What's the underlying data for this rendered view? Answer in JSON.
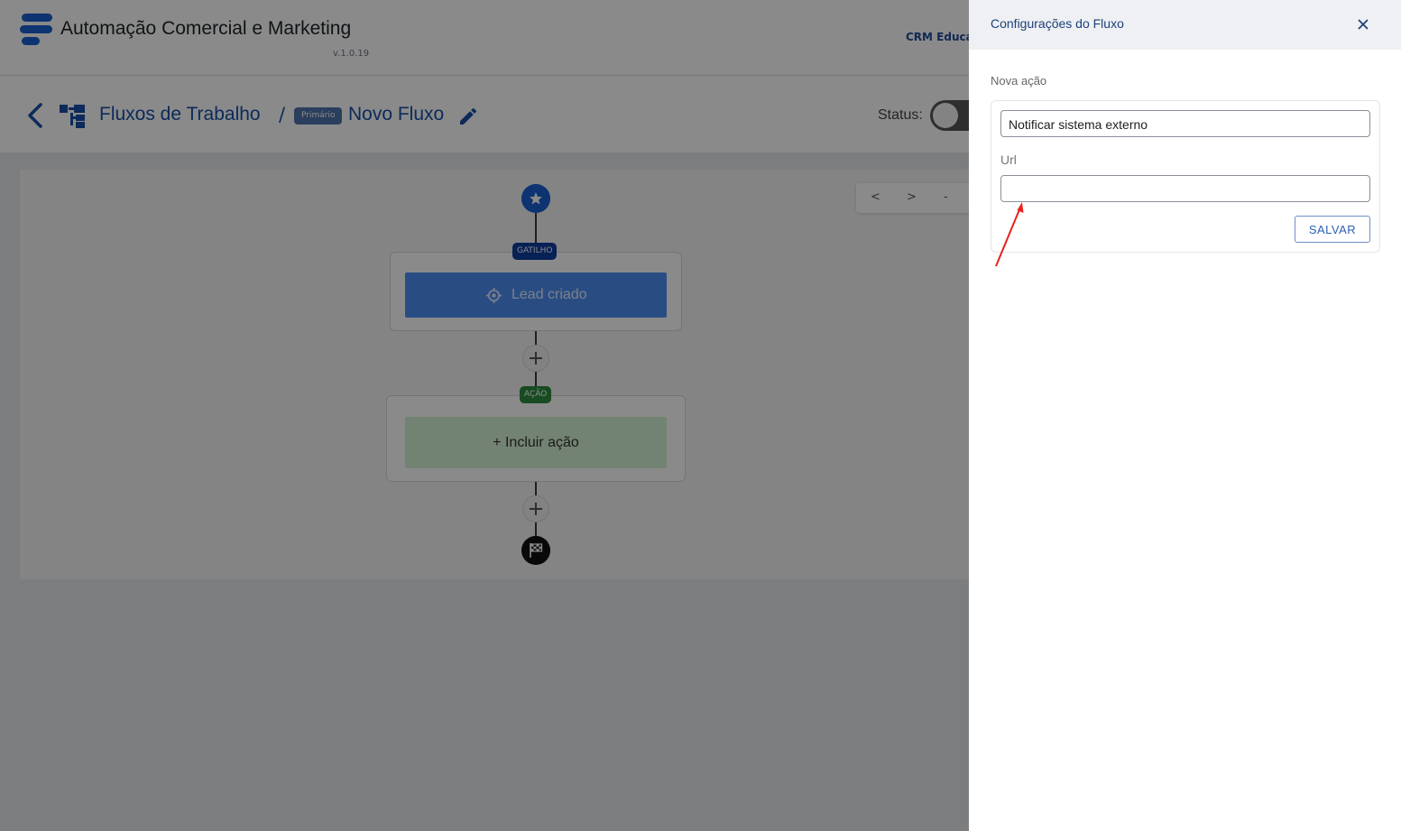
{
  "app": {
    "title": "Automação Comercial e Marketing",
    "version": "v.1.0.19",
    "org_name": "CRM Educac",
    "brand_color": "#1a5fd1"
  },
  "breadcrumb": {
    "section": "Fluxos de Trabalho",
    "separator": "/",
    "badge": "Primário",
    "flow_name": "Novo Fluxo"
  },
  "status": {
    "label": "Status:",
    "enabled": false
  },
  "zoom": {
    "prev": "<",
    "next": ">",
    "zoom_out": "-"
  },
  "flow": {
    "trigger_tag": "GATILHO",
    "trigger_label": "Lead criado",
    "action_tag": "AÇÃO",
    "add_action_label": "+ Incluir ação"
  },
  "drawer": {
    "title": "Configurações do Fluxo",
    "section_label": "Nova ação",
    "action_value": "Notificar sistema externo",
    "url_label": "Url",
    "url_value": "",
    "save_label": "SALVAR"
  }
}
